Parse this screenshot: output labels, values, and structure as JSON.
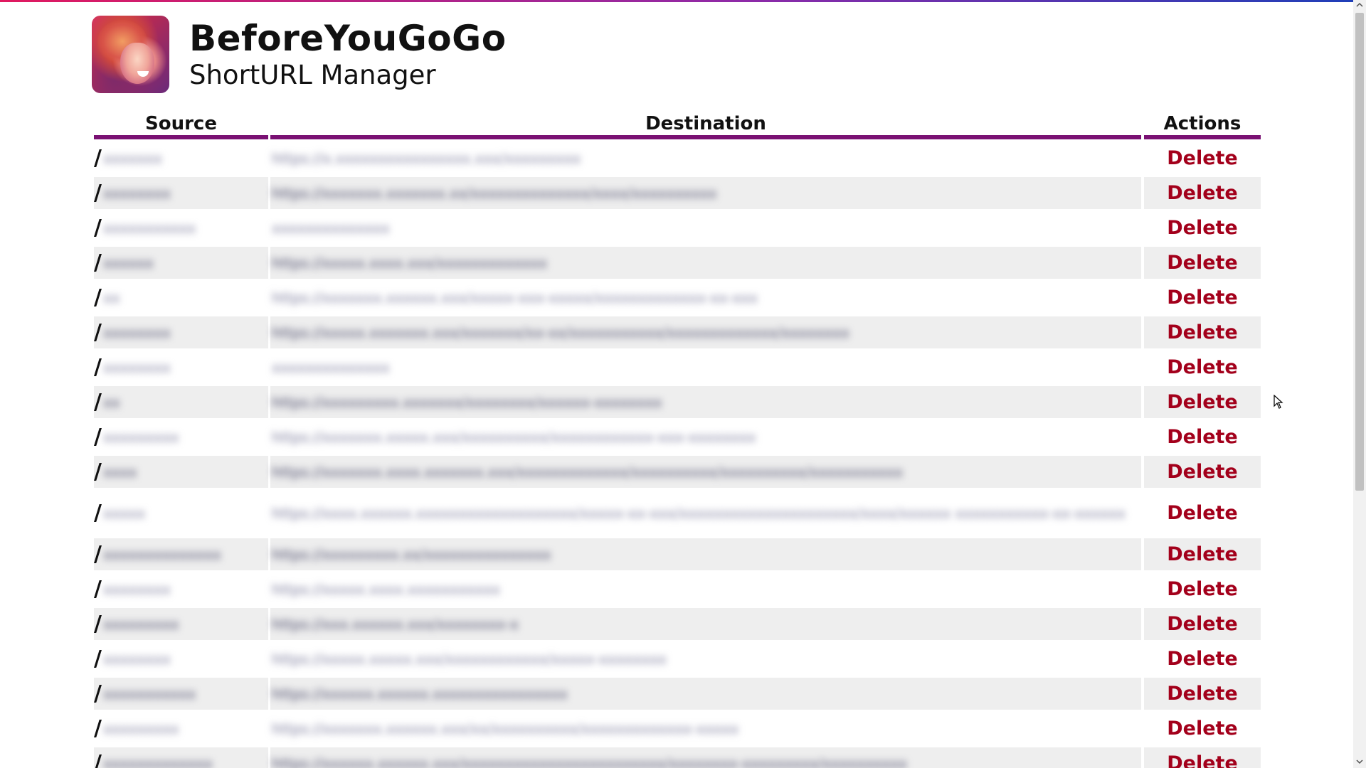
{
  "app": {
    "title": "BeforeYouGoGo",
    "subtitle": "ShortURL Manager",
    "logo_icon": "avatar-photo"
  },
  "colors": {
    "accent": "#7a1173",
    "delete": "#a3001b",
    "row_alt": "#eeeeee"
  },
  "table": {
    "headers": {
      "source": "Source",
      "destination": "Destination",
      "actions": "Actions"
    },
    "rows": [
      {
        "slash": "/",
        "source": "xxxxxxx",
        "destination": "https://x.xxxxxxxxxxxxxxxx.xxx/xxxxxxxxx",
        "action": "Delete"
      },
      {
        "slash": "/",
        "source": "xxxxxxxx",
        "destination": "https://xxxxxxx.xxxxxxx.xx/xxxxxxxxxxxxxx/xxxx/xxxxxxxxxx",
        "action": "Delete"
      },
      {
        "slash": "/",
        "source": "xxxxxxxxxxx",
        "destination": "xxxxxxxxxxxxxx",
        "action": "Delete"
      },
      {
        "slash": "/",
        "source": "xxxxxx",
        "destination": "https://xxxxx.xxxx.xxx/xxxxxxxxxxxxx",
        "action": "Delete"
      },
      {
        "slash": "/",
        "source": "xx",
        "destination": "https://xxxxxxx.xxxxxx.xxx/xxxxx-xxx-xxxxx/xxxxxxxxxxxxx-xx-xxx",
        "action": "Delete"
      },
      {
        "slash": "/",
        "source": "xxxxxxxx",
        "destination": "https://xxxxx.xxxxxxx.xxx/xxxxxxx/xx-xx/xxxxxxxxxxx/xxxxxxxxxxxxx/xxxxxxxx",
        "action": "Delete"
      },
      {
        "slash": "/",
        "source": "xxxxxxxx",
        "destination": "xxxxxxxxxxxxxx",
        "action": "Delete"
      },
      {
        "slash": "/",
        "source": "xx",
        "destination": "https://xxxxxxxxx.xxxxxxx/xxxxxxxx/xxxxxx-xxxxxxxx",
        "action": "Delete"
      },
      {
        "slash": "/",
        "source": "xxxxxxxxx",
        "destination": "https://xxxxxxx.xxxxx.xxx/xxxxxxxxxx/xxxxxxxxxxxx-xxx-xxxxxxxx",
        "action": "Delete"
      },
      {
        "slash": "/",
        "source": "xxxx",
        "destination": "https://xxxxxxx.xxxx.xxxxxxx.xxx/xxxxxxxxxxxxx/xxxxxxxxxx/xxxxxxxxxx/xxxxxxxxxxx",
        "action": "Delete"
      },
      {
        "slash": "/",
        "source": "xxxxx",
        "destination": "https://xxxx.xxxxxx.xxxxxxxxxxxxxxxxxxx/xxxxx-xx-xxx/xxxxxxxxxxxxxxxxxxxxx/xxxx/xxxxxx xxxxxxxxxxx-xx-xxxxxx",
        "action": "Delete",
        "tall": true
      },
      {
        "slash": "/",
        "source": "xxxxxxxxxxxxxx",
        "destination": "https://xxxxxxxxx.xx/xxxxxxxxxxxxxxx",
        "action": "Delete"
      },
      {
        "slash": "/",
        "source": "xxxxxxxx",
        "destination": "https://xxxxx.xxxx.xxxxxxxxxxx",
        "action": "Delete"
      },
      {
        "slash": "/",
        "source": "xxxxxxxxx",
        "destination": "https://xxx.xxxxxx.xxx/xxxxxxxx-x",
        "action": "Delete"
      },
      {
        "slash": "/",
        "source": "xxxxxxxx",
        "destination": "https://xxxxx.xxxxx.xxx/xxxxxxxxxxxx/xxxxx-xxxxxxxx",
        "action": "Delete"
      },
      {
        "slash": "/",
        "source": "xxxxxxxxxxx",
        "destination": "https://xxxxxx.xxxxxx.xxxxxxxxxxxxxxxx",
        "action": "Delete"
      },
      {
        "slash": "/",
        "source": "xxxxxxxxx",
        "destination": "https://xxxxxxx.xxxxxx.xxx/xx/xxxxxxxxxx/xxxxxxxxxxxxx-xxxxx",
        "action": "Delete"
      },
      {
        "slash": "/",
        "source": "xxxxxxxxxxxxx",
        "destination": "https://xxxxxx.xxxxxx.xxx/xxxxxxxxxxxxxxxxxxxxxxxx/xxxxxxxx-xxxxxxxxx/xxxxxxxxxx",
        "action": "Delete"
      }
    ]
  },
  "scrollbar": {
    "up_icon": "chevron-up-icon",
    "down_icon": "chevron-down-icon"
  },
  "cursor": {
    "icon": "mouse-pointer-icon"
  }
}
